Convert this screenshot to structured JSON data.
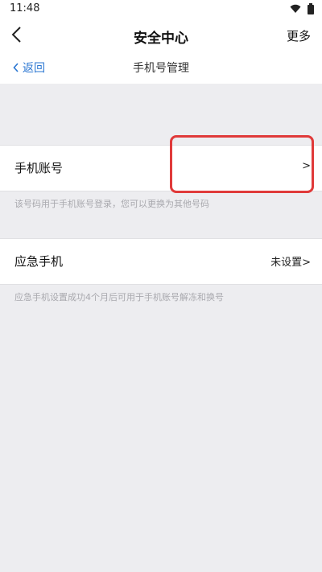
{
  "status_bar": {
    "time": "11:48"
  },
  "app_bar": {
    "title": "安全中心",
    "more_label": "更多"
  },
  "sub_bar": {
    "back_label": "返回",
    "title": "手机号管理"
  },
  "rows": [
    {
      "label": "手机账号",
      "value": ">",
      "hint": "该号码用于手机账号登录，您可以更换为其他号码"
    },
    {
      "label": "应急手机",
      "value": "未设置>",
      "hint": "应急手机设置成功4个月后可用于手机账号解冻和换号"
    }
  ],
  "colors": {
    "accent": "#2a76d2",
    "highlight": "#e03a3a",
    "background": "#ededf0"
  }
}
